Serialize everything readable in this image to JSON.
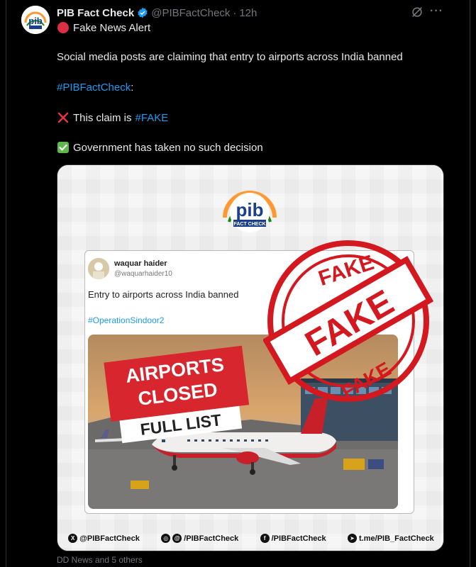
{
  "tweet": {
    "author_name": "PIB Fact Check",
    "handle": "@PIBFactCheck",
    "separator": "·",
    "time": "12h",
    "alert_line": "Fake News Alert",
    "claim_line": "Social media posts are claiming that entry to airports across India banned",
    "hashtag_line": "#PIBFactCheck",
    "hashtag_suffix": ":",
    "verdict_prefix": "This claim is",
    "verdict_tag": "#FAKE",
    "decision_line": "Government has taken no such decision"
  },
  "image": {
    "logo_main": "pib",
    "logo_sub": "FACT CHECK",
    "embedded_post": {
      "name": "waquar haider",
      "handle": "@waquarhaider10",
      "text": "Entry to airports across India banned",
      "tag": "#OperationSindoor2"
    },
    "photo_banner": [
      "AIRPORTS",
      "CLOSED",
      "FULL LIST"
    ],
    "stamp": {
      "top": "FAKE",
      "middle": "FAKE",
      "bottom": "FAKE"
    },
    "footer": [
      {
        "icon": "x-logo-icon",
        "label": "@PIBFactCheck"
      },
      {
        "icon": "instagram-threads-icon",
        "label": "/PIBFactCheck"
      },
      {
        "icon": "facebook-icon",
        "label": "/PIBFactCheck"
      },
      {
        "icon": "telegram-icon",
        "label": "t.me/PIB_FactCheck"
      }
    ]
  },
  "caption": "DD News and 5 others",
  "colors": {
    "link": "#1d9bf0",
    "stamp_red": "#d3181f",
    "verified": "#1d9bf0",
    "dim_text": "#71767b"
  }
}
